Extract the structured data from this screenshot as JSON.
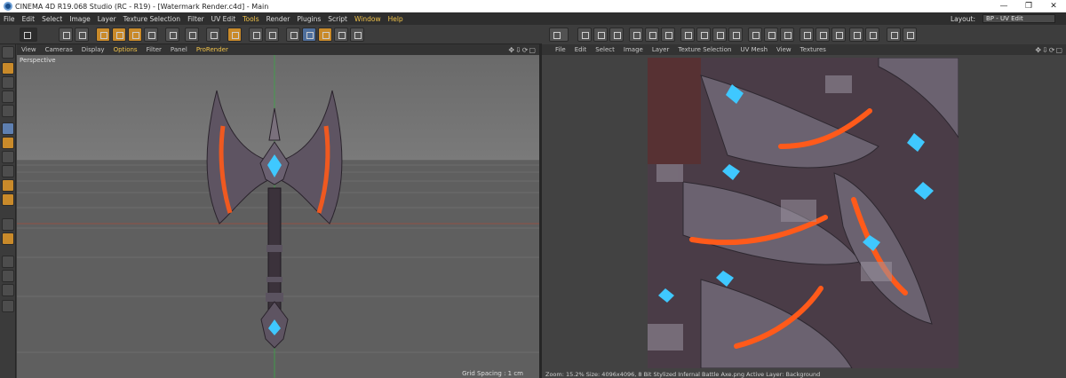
{
  "titlebar": {
    "title": "CINEMA 4D R19.068 Studio (RC - R19) - [Watermark Render.c4d] - Main",
    "minimize": "—",
    "maximize": "❐",
    "close": "✕"
  },
  "menubar": {
    "items": [
      {
        "label": "File",
        "highlight": false
      },
      {
        "label": "Edit",
        "highlight": false
      },
      {
        "label": "Select",
        "highlight": false
      },
      {
        "label": "Image",
        "highlight": false
      },
      {
        "label": "Layer",
        "highlight": false
      },
      {
        "label": "Texture Selection",
        "highlight": false
      },
      {
        "label": "Filter",
        "highlight": false
      },
      {
        "label": "UV Edit",
        "highlight": false
      },
      {
        "label": "Tools",
        "highlight": true
      },
      {
        "label": "Render",
        "highlight": false
      },
      {
        "label": "Plugins",
        "highlight": false
      },
      {
        "label": "Script",
        "highlight": false
      },
      {
        "label": "Window",
        "highlight": true
      },
      {
        "label": "Help",
        "highlight": true
      }
    ],
    "layout_label": "Layout:",
    "layout_value": "BP - UV Edit"
  },
  "left_viewport": {
    "menu": [
      "View",
      "Cameras",
      "Display",
      "Options",
      "Filter",
      "Panel",
      "ProRender"
    ],
    "menu_highlight": [
      "Options",
      "ProRender"
    ],
    "label": "Perspective",
    "grid_spacing": "Grid Spacing : 1 cm"
  },
  "uv_viewport": {
    "menu": [
      "File",
      "Edit",
      "Select",
      "Image",
      "Layer",
      "Texture Selection",
      "UV Mesh",
      "View",
      "Textures"
    ],
    "status": "Zoom: 15.2%  Size: 4096x4096, 8 Bit  Stylized Infernal Battle Axe.png  Active Layer: Background"
  },
  "colors": {
    "accent": "#f1c34a",
    "glow": "#ff5a1a",
    "gem": "#3fc8ff"
  }
}
